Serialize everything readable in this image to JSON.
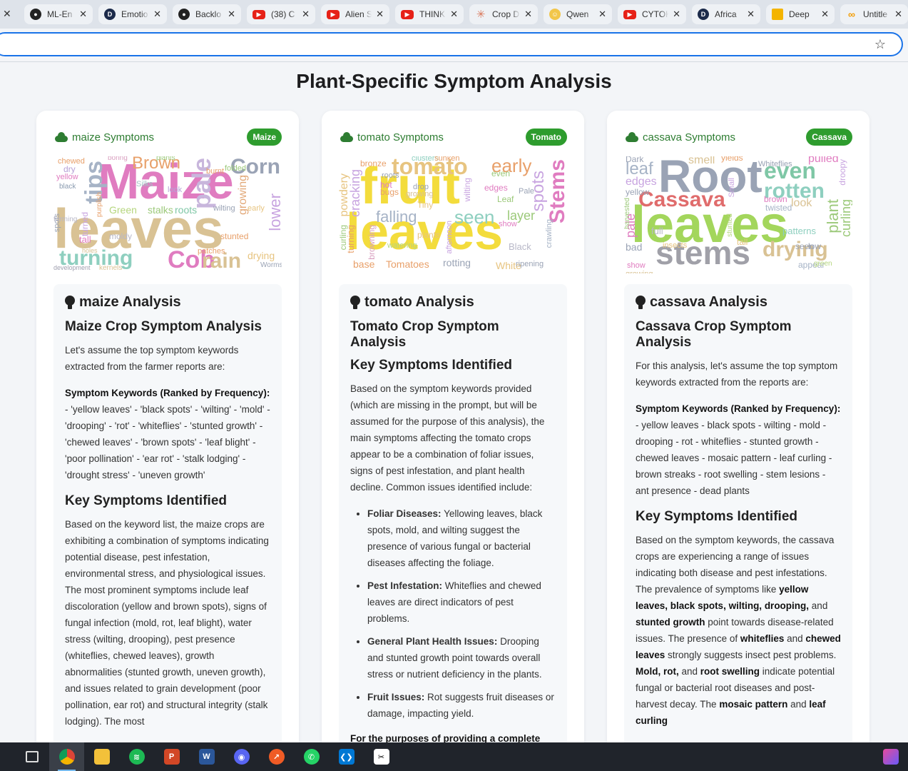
{
  "browser": {
    "tabs": [
      {
        "label": "ML-En",
        "icon": "github-icon"
      },
      {
        "label": "Emotio",
        "icon": "d-app-icon"
      },
      {
        "label": "Backlo",
        "icon": "github-icon"
      },
      {
        "label": "(38) C",
        "icon": "youtube-icon"
      },
      {
        "label": "Alien S",
        "icon": "youtube-icon"
      },
      {
        "label": "THINK",
        "icon": "youtube-icon"
      },
      {
        "label": "Crop D",
        "icon": "claude-icon"
      },
      {
        "label": "Qwen",
        "icon": "qwen-icon"
      },
      {
        "label": "CYTOK",
        "icon": "youtube-icon"
      },
      {
        "label": "Africa",
        "icon": "d-app-icon"
      },
      {
        "label": "Deep",
        "icon": "slides-icon"
      },
      {
        "label": "Untitle",
        "icon": "colab-icon"
      }
    ],
    "close_glyph": "✕",
    "star_glyph": "☆"
  },
  "page": {
    "title": "Plant-Specific Symptom Analysis"
  },
  "cards": [
    {
      "title": "maize Symptoms",
      "badge": "Maize",
      "analysis_title": "maize Analysis",
      "h_main": "Maize Crop Symptom Analysis",
      "intro": "Let's assume the top symptom keywords extracted from the farmer reports are:",
      "kw_label": "Symptom Keywords (Ranked by Frequency):",
      "kw_text": " - 'yellow leaves' - 'black spots' - 'wilting' - 'mold' - 'drooping' - 'rot' - 'whiteflies' - 'stunted growth' - 'chewed leaves' - 'brown spots' - 'leaf blight' - 'poor pollination' - 'ear rot' - 'stalk lodging' - 'drought stress' - 'uneven growth'",
      "h_key": "Key Symptoms Identified",
      "key_text": "Based on the keyword list, the maize crops are exhibiting a combination of symptoms indicating potential disease, pest infestation, environmental stress, and physiological issues. The most prominent symptoms include leaf discoloration (yellow and brown spots), signs of fungal infection (mold, rot, leaf blight), water stress (wilting, drooping), pest presence (whiteflies, chewed leaves), growth abnormalities (stunted growth, uneven growth), and issues related to grain development (poor pollination, ear rot) and structural integrity (stalk lodging). The most"
    },
    {
      "title": "tomato Symptoms",
      "badge": "Tomato",
      "analysis_title": "tomato Analysis",
      "h_main": "Tomato Crop Symptom Analysis",
      "h_key": "Key Symptoms Identified",
      "key_text": "Based on the symptom keywords provided (which are missing in the prompt, but will be assumed for the purpose of this analysis), the main symptoms affecting the tomato crops appear to be a combination of foliar issues, signs of pest infestation, and plant health decline. Common issues identified include:",
      "bullets": [
        {
          "b": "Foliar Diseases:",
          "t": " Yellowing leaves, black spots, mold, and wilting suggest the presence of various fungal or bacterial diseases affecting the foliage."
        },
        {
          "b": "Pest Infestation:",
          "t": " Whiteflies and chewed leaves are direct indicators of pest problems."
        },
        {
          "b": "General Plant Health Issues:",
          "t": " Drooping and stunted growth point towards overall stress or nutrient deficiency in the plants."
        },
        {
          "b": "Fruit Issues:",
          "t": " Rot suggests fruit diseases or damage, impacting yield."
        }
      ],
      "closing": "For the purposes of providing a complete"
    },
    {
      "title": "cassava Symptoms",
      "badge": "Cassava",
      "analysis_title": "cassava Analysis",
      "h_main": "Cassava Crop Symptom Analysis",
      "intro": "For this analysis, let's assume the top symptom keywords extracted from the reports are:",
      "kw_label": "Symptom Keywords (Ranked by Frequency):",
      "kw_text": " - yellow leaves - black spots - wilting - mold - drooping - rot - whiteflies - stunted growth - chewed leaves - mosaic pattern - leaf curling - brown streaks - root swelling - stem lesions - ant presence - dead plants",
      "h_key": "Key Symptoms Identified",
      "key_parts": [
        {
          "t": "Based on the symptom keywords, the cassava crops are experiencing a range of issues indicating both disease and pest infestations. The prevalence of symptoms like "
        },
        {
          "b": "yellow leaves, black spots, wilting, drooping,"
        },
        {
          "t": " and "
        },
        {
          "b": "stunted growth"
        },
        {
          "t": " point towards disease-related issues. The presence of "
        },
        {
          "b": "whiteflies"
        },
        {
          "t": " and "
        },
        {
          "b": "chewed leaves"
        },
        {
          "t": " strongly suggests insect pest problems. "
        },
        {
          "b": "Mold, rot,"
        },
        {
          "t": " and "
        },
        {
          "b": "root swelling"
        },
        {
          "t": " indicate potential fungal or bacterial root diseases and post-harvest decay. The "
        },
        {
          "b": "mosaic pattern"
        },
        {
          "t": " and "
        },
        {
          "b": "leaf curling"
        }
      ]
    }
  ],
  "wordclouds": [
    {
      "words": [
        {
          "w": "Maize",
          "c": "#e07cc0"
        },
        {
          "w": "leaves",
          "c": "#d9c294"
        },
        {
          "w": "Brown",
          "c": "#e8a06a"
        },
        {
          "w": "Corn",
          "c": "#9aa3b5"
        },
        {
          "w": "tips",
          "c": "#a6b3c6"
        },
        {
          "w": "pale",
          "c": "#c8b6dc"
        },
        {
          "w": "turning",
          "c": "#8ecfbf"
        },
        {
          "w": "Cob",
          "c": "#e07cc0"
        },
        {
          "w": "rain",
          "c": "#d9c294"
        },
        {
          "w": "lower",
          "c": "#c8a4e0"
        },
        {
          "w": "growing",
          "c": "#e2a878"
        },
        {
          "w": "Green",
          "c": "#b5d67e"
        },
        {
          "w": "stalks",
          "c": "#9cc97a"
        },
        {
          "w": "roots",
          "c": "#7fc7a6"
        },
        {
          "w": "drying",
          "c": "#e7c480"
        },
        {
          "w": "moldy",
          "c": "#b8b8c8"
        },
        {
          "w": "stunted",
          "c": "#e8a06a"
        },
        {
          "w": "chewed",
          "c": "#e8a06a"
        },
        {
          "w": "dry",
          "c": "#b5a0d6"
        },
        {
          "w": "yellow",
          "c": "#e07cc0"
        },
        {
          "w": "burnt",
          "c": "#e8a06a"
        },
        {
          "w": "folded",
          "c": "#9cc97a"
        },
        {
          "w": "Silks",
          "c": "#a0c4c4"
        },
        {
          "w": "wilting",
          "c": "#9aa3b5"
        },
        {
          "w": "early",
          "c": "#e7c480"
        },
        {
          "w": "patches",
          "c": "#e8a06a"
        },
        {
          "w": "kernels",
          "c": "#d9c294"
        },
        {
          "w": "Worms",
          "c": "#9aa3b5"
        },
        {
          "w": "plants",
          "c": "#9cc97a"
        },
        {
          "w": "boring",
          "c": "#d9a0c0"
        },
        {
          "w": "black",
          "c": "#8a9bb0"
        },
        {
          "w": "look",
          "c": "#b5a0d6"
        },
        {
          "w": "tall",
          "c": "#e07cc0"
        },
        {
          "w": "spots",
          "c": "#9aa3b5"
        },
        {
          "w": "turned",
          "c": "#c8a4e0"
        },
        {
          "w": "purplish",
          "c": "#e8a06a"
        },
        {
          "w": "forming",
          "c": "#b8b8c8"
        },
        {
          "w": "development",
          "c": "#a0a0b0"
        },
        {
          "w": "holes",
          "c": "#d9c294"
        }
      ]
    },
    {
      "words": [
        {
          "w": "fruit",
          "c": "#f3dc3c"
        },
        {
          "w": "leaves",
          "c": "#f3dc3c"
        },
        {
          "w": "tomato",
          "c": "#e7c480"
        },
        {
          "w": "early",
          "c": "#e8a06a"
        },
        {
          "w": "Stems",
          "c": "#e07cc0"
        },
        {
          "w": "spots",
          "c": "#c8a4e0"
        },
        {
          "w": "seen",
          "c": "#8ecfbf"
        },
        {
          "w": "falling",
          "c": "#a6b3c6"
        },
        {
          "w": "layer",
          "c": "#9cc97a"
        },
        {
          "w": "cracking",
          "c": "#c8a4e0"
        },
        {
          "w": "powdery",
          "c": "#e7c480"
        },
        {
          "w": "base",
          "c": "#e8a06a"
        },
        {
          "w": "Tomatoes",
          "c": "#e8a06a"
        },
        {
          "w": "rotting",
          "c": "#9aa3b5"
        },
        {
          "w": "White",
          "c": "#e7c480"
        },
        {
          "w": "ripening",
          "c": "#9aa3b5"
        },
        {
          "w": "bronze",
          "c": "#e8a06a"
        },
        {
          "w": "even",
          "c": "#9cc97a"
        },
        {
          "w": "edges",
          "c": "#e07cc0"
        },
        {
          "w": "Leaf",
          "c": "#9cc97a"
        },
        {
          "w": "Tiny",
          "c": "#e7c480"
        },
        {
          "w": "Black",
          "c": "#b8b8c8"
        },
        {
          "w": "wilting",
          "c": "#c8a4e0"
        },
        {
          "w": "bugs",
          "c": "#e8a06a"
        },
        {
          "w": "hot",
          "c": "#e07cc0"
        },
        {
          "w": "curling",
          "c": "#9cc97a"
        },
        {
          "w": "turning",
          "c": "#e8a06a"
        },
        {
          "w": "browning",
          "c": "#d9a0c0"
        },
        {
          "w": "watering",
          "c": "#b5d67e"
        },
        {
          "w": "plants",
          "c": "#e7c480"
        },
        {
          "w": "crawling",
          "c": "#a6b3c6"
        },
        {
          "w": "afternoon",
          "c": "#c8a4e0"
        },
        {
          "w": "Pale",
          "c": "#9aa3b5"
        },
        {
          "w": "drop",
          "c": "#9aa3b5"
        },
        {
          "w": "growing",
          "c": "#d9c294"
        },
        {
          "w": "clusters",
          "c": "#8ecfbf"
        },
        {
          "w": "sunken",
          "c": "#e8a06a"
        },
        {
          "w": "roots",
          "c": "#9aa3b5"
        },
        {
          "w": "show",
          "c": "#e07cc0"
        }
      ]
    },
    {
      "words": [
        {
          "w": "Root",
          "c": "#9aa3b5"
        },
        {
          "w": "leaves",
          "c": "#a3d65c"
        },
        {
          "w": "stems",
          "c": "#a0a0a8"
        },
        {
          "w": "Cassava",
          "c": "#e06c6c"
        },
        {
          "w": "even",
          "c": "#7fc7a6"
        },
        {
          "w": "rotten",
          "c": "#8ecfbf"
        },
        {
          "w": "drying",
          "c": "#d9c294"
        },
        {
          "w": "leaf",
          "c": "#a6b3c6"
        },
        {
          "w": "edges",
          "c": "#c8a4e0"
        },
        {
          "w": "smell",
          "c": "#d9c294"
        },
        {
          "w": "pulled",
          "c": "#e07cc0"
        },
        {
          "w": "plant",
          "c": "#9cc97a"
        },
        {
          "w": "curling",
          "c": "#9cc97a"
        },
        {
          "w": "look",
          "c": "#d9c294"
        },
        {
          "w": "patterns",
          "c": "#8ecfbf"
        },
        {
          "w": "yellow",
          "c": "#9aa3b5"
        },
        {
          "w": "bad",
          "c": "#9aa3b5"
        },
        {
          "w": "full",
          "c": "#b8b8c8"
        },
        {
          "w": "twisted",
          "c": "#a6b3c6"
        },
        {
          "w": "brown",
          "c": "#e07cc0"
        },
        {
          "w": "insects",
          "c": "#e7c480"
        },
        {
          "w": "seen",
          "c": "#9aa3b5"
        },
        {
          "w": "low",
          "c": "#9aa3b5"
        },
        {
          "w": "appear",
          "c": "#a6b3c6"
        },
        {
          "w": "green",
          "c": "#b5d67e"
        },
        {
          "w": "show",
          "c": "#e07cc0"
        },
        {
          "w": "growing",
          "c": "#d9c294"
        },
        {
          "w": "Dark",
          "c": "#9aa3b5"
        },
        {
          "w": "yields",
          "c": "#e8a06a"
        },
        {
          "w": "Whiteflies",
          "c": "#9aa3b5"
        },
        {
          "w": "tall",
          "c": "#e7c480"
        },
        {
          "w": "pale",
          "c": "#e07cc0"
        },
        {
          "w": "droopy",
          "c": "#c8a4e0"
        },
        {
          "w": "Small",
          "c": "#c8a4e0"
        },
        {
          "w": "harvested",
          "c": "#9cc97a"
        },
        {
          "w": "stunted",
          "c": "#b5d67e"
        }
      ]
    }
  ]
}
